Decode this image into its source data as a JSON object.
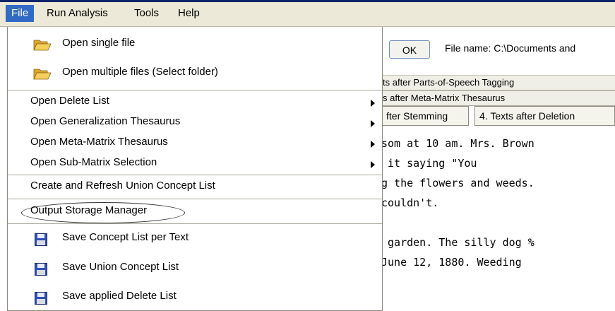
{
  "menubar": {
    "items": [
      "File",
      "Run Analysis",
      "Tools",
      "Help"
    ]
  },
  "app": {
    "ok_label": "OK",
    "file_name_text": "File name: C:\\Documents and",
    "tab_rows": [
      "ts after Parts-of-Speech Tagging",
      "s after Meta-Matrix Thesaurus"
    ],
    "tabs": [
      "fter Stemming",
      "4. Texts after Deletion"
    ],
    "text_lines": [
      "som at 10 am. Mrs. Brown",
      " it saying \"You",
      "g the flowers and weeds.",
      "couldn't.",
      "",
      " garden. The silly dog %",
      "June 12, 1880. Weeding"
    ]
  },
  "file_menu": {
    "open_single": "Open single file",
    "open_multiple": "Open multiple files (Select folder)",
    "open_delete": "Open Delete List",
    "open_generalization": "Open Generalization Thesaurus",
    "open_meta_matrix": "Open Meta-Matrix Thesaurus",
    "open_sub_matrix": "Open Sub-Matrix Selection",
    "create_refresh": "Create and Refresh Union Concept List",
    "output_storage": "Output Storage Manager",
    "save_concept_per_text": "Save Concept List per Text",
    "save_union": "Save Union Concept List",
    "save_delete": "Save applied Delete List"
  },
  "icons": {
    "folder": "folder-open-icon",
    "save": "floppy-disk-icon",
    "submenu": "submenu-arrow-icon"
  },
  "colors": {
    "menu_highlight": "#316ac5",
    "menubar_bg": "#ece9d8"
  }
}
